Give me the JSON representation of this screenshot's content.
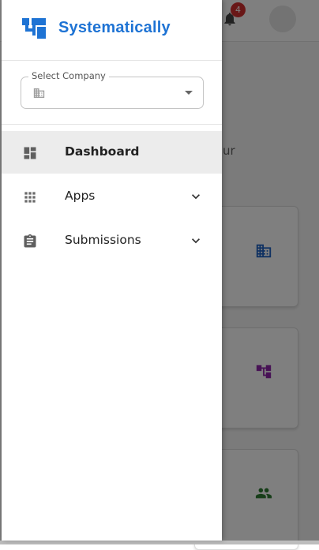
{
  "header": {
    "notification_count": "4",
    "page_heading_fragment": "",
    "page_subtext_fragment": "ur"
  },
  "drawer": {
    "brand_name": "Systematically",
    "company_select": {
      "label": "Select Company",
      "value": ""
    },
    "nav": [
      {
        "label": "Dashboard",
        "icon": "dashboard-icon",
        "active": true
      },
      {
        "label": "Apps",
        "icon": "apps-grid-icon",
        "expandable": true
      },
      {
        "label": "Submissions",
        "icon": "clipboard-icon",
        "expandable": true
      }
    ]
  },
  "colors": {
    "brand": "#1e73d4",
    "badge": "#d32f2f",
    "card_icon_building": "#1e63c4",
    "card_icon_org": "#8e24aa",
    "card_icon_users": "#2e7d32"
  }
}
